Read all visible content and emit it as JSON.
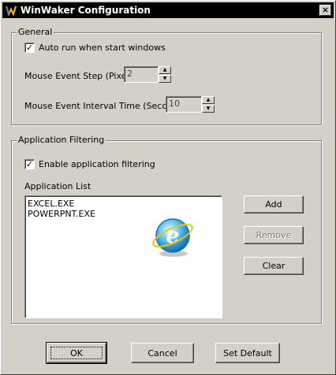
{
  "window": {
    "title": "WinWaker Configuration",
    "close_glyph": "×"
  },
  "general": {
    "group_title": "General",
    "auto_run": {
      "label": "Auto run when start windows",
      "checked": true
    },
    "mouse_step": {
      "label": "Mouse Event Step (Pixel)",
      "value": "2"
    },
    "mouse_interval": {
      "label": "Mouse Event Interval Time  (Second)",
      "value": "10"
    }
  },
  "filtering": {
    "group_title": "Application Filtering",
    "enable": {
      "label": "Enable application filtering",
      "checked": true
    },
    "list_label": "Application List",
    "applications": [
      "EXCEL.EXE",
      "POWERPNT.EXE"
    ],
    "buttons": {
      "add": "Add",
      "remove": "Remove",
      "clear": "Clear"
    }
  },
  "footer": {
    "ok": "OK",
    "cancel": "Cancel",
    "set_default": "Set Default"
  },
  "icons": {
    "app": "winwaker-app-icon",
    "logo": "internet-explorer-logo",
    "check": "✓",
    "spin_up": "▲",
    "spin_down": "▼"
  },
  "colors": {
    "window_bg": "#d4d0c8",
    "titlebar": "#000000",
    "disabled_text": "#808080"
  }
}
